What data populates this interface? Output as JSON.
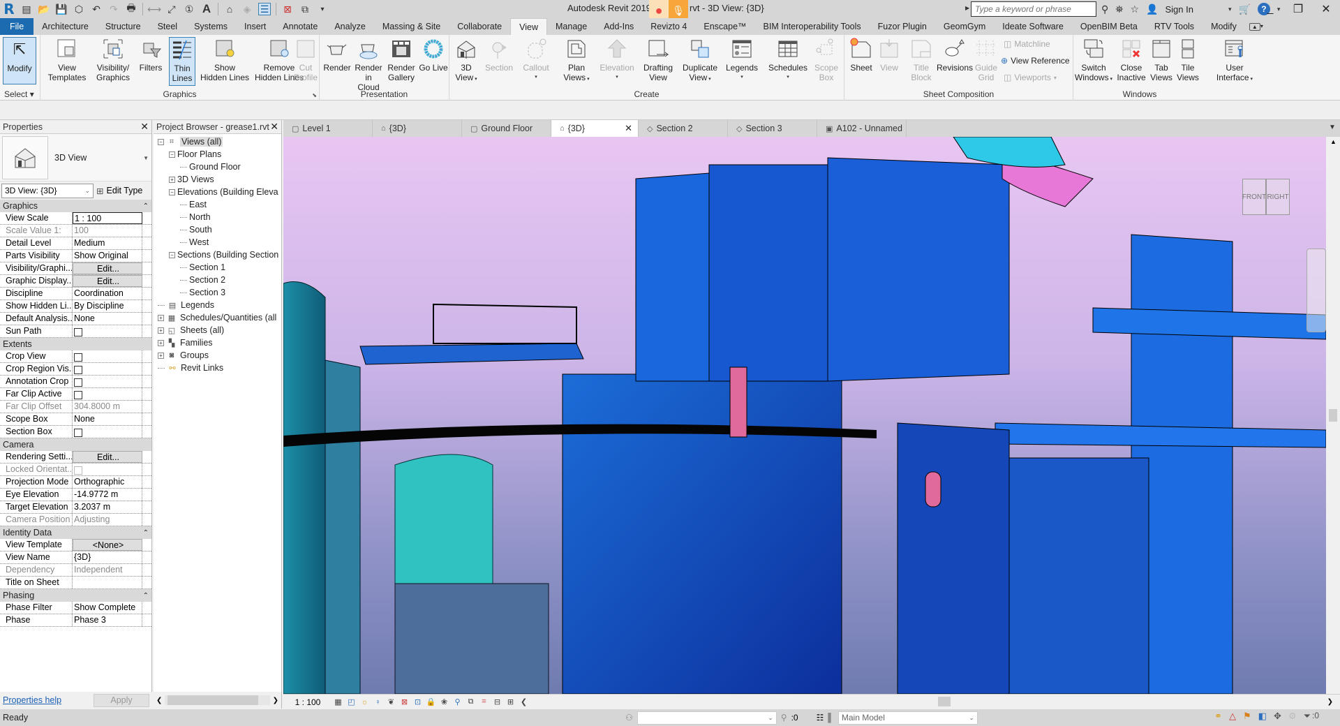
{
  "app": {
    "title_prefix": "Autodesk Revit 2019.2",
    "title_suffix": "rvt - 3D View: {3D}",
    "search_placeholder": "Type a keyword or phrase",
    "sign_in": "Sign In",
    "help": "?"
  },
  "quick_access": [
    "revit-logo",
    "recent-files",
    "open",
    "save",
    "sync",
    "undo",
    "redo",
    "print",
    "measure",
    "aligned-dimension",
    "tag",
    "text",
    "default-3d-view",
    "section",
    "thin-lines",
    "close-hidden-windows",
    "switch-windows",
    "customize"
  ],
  "ribbon_tabs": [
    "File",
    "Architecture",
    "Structure",
    "Steel",
    "Systems",
    "Insert",
    "Annotate",
    "Analyze",
    "Massing & Site",
    "Collaborate",
    "View",
    "Manage",
    "Add-Ins",
    "Revizto 4",
    "Enscape™",
    "BIM Interoperability Tools",
    "Fuzor Plugin",
    "GeomGym",
    "Ideate Software",
    "OpenBIM Beta",
    "RTV Tools",
    "Modify"
  ],
  "active_tab": "View",
  "ribbon": {
    "select": {
      "title": "Select",
      "modify": "Modify"
    },
    "graphics": {
      "title": "Graphics",
      "view_templates": [
        "View",
        "Templates"
      ],
      "visibility": [
        "Visibility/",
        "Graphics"
      ],
      "filters": "Filters",
      "thin_lines": [
        "Thin",
        "Lines"
      ],
      "show_hidden": [
        "Show",
        "Hidden Lines"
      ],
      "remove_hidden": [
        "Remove",
        "Hidden Lines"
      ],
      "cut_profile": [
        "Cut",
        "Profile"
      ]
    },
    "presentation": {
      "title": "Presentation",
      "render": "Render",
      "render_cloud": [
        "Render",
        "in Cloud"
      ],
      "render_gallery": [
        "Render",
        "Gallery"
      ],
      "go_live": "Go Live"
    },
    "create": {
      "title": "Create",
      "view3d": [
        "3D",
        "View"
      ],
      "section": "Section",
      "callout": "Callout",
      "plan_views": [
        "Plan",
        "Views"
      ],
      "elevation": "Elevation",
      "drafting": [
        "Drafting",
        "View"
      ],
      "duplicate": [
        "Duplicate",
        "View"
      ],
      "legends": "Legends",
      "schedules": "Schedules",
      "scope_box": [
        "Scope",
        "Box"
      ]
    },
    "sheet_composition": {
      "title": "Sheet Composition",
      "sheet": "Sheet",
      "view": "View",
      "title_block": [
        "Title",
        "Block"
      ],
      "revisions": "Revisions",
      "guide_grid": [
        "Guide",
        "Grid"
      ],
      "matchline": "Matchline",
      "view_reference": "View  Reference",
      "viewports": "Viewports"
    },
    "windows": {
      "title": "Windows",
      "switch": [
        "Switch",
        "Windows"
      ],
      "close_inactive": [
        "Close",
        "Inactive"
      ],
      "tab_views": [
        "Tab",
        "Views"
      ],
      "tile_views": [
        "Tile",
        "Views"
      ],
      "user_interface": [
        "User",
        "Interface"
      ]
    }
  },
  "properties": {
    "title": "Properties",
    "type_name": "3D View",
    "type_selector": "3D View: {3D}",
    "edit_type": "Edit Type",
    "sections": [
      {
        "name": "Graphics",
        "rows": [
          {
            "k": "View Scale",
            "v": "1 : 100",
            "style": "input"
          },
          {
            "k": "Scale Value    1:",
            "v": "100",
            "style": "dim"
          },
          {
            "k": "Detail Level",
            "v": "Medium"
          },
          {
            "k": "Parts Visibility",
            "v": "Show Original"
          },
          {
            "k": "Visibility/Graphi...",
            "v": "Edit...",
            "style": "button"
          },
          {
            "k": "Graphic Display...",
            "v": "Edit...",
            "style": "button"
          },
          {
            "k": "Discipline",
            "v": "Coordination"
          },
          {
            "k": "Show Hidden Li...",
            "v": "By Discipline"
          },
          {
            "k": "Default Analysis...",
            "v": "None"
          },
          {
            "k": "Sun Path",
            "v": "",
            "style": "checkbox",
            "checked": false
          }
        ]
      },
      {
        "name": "Extents",
        "rows": [
          {
            "k": "Crop View",
            "v": "",
            "style": "checkbox",
            "checked": false
          },
          {
            "k": "Crop Region Vis...",
            "v": "",
            "style": "checkbox",
            "checked": false
          },
          {
            "k": "Annotation Crop",
            "v": "",
            "style": "checkbox",
            "checked": false
          },
          {
            "k": "Far Clip Active",
            "v": "",
            "style": "checkbox",
            "checked": false
          },
          {
            "k": "Far Clip Offset",
            "v": "304.8000 m",
            "style": "dim"
          },
          {
            "k": "Scope Box",
            "v": "None"
          },
          {
            "k": "Section Box",
            "v": "",
            "style": "checkbox",
            "checked": false
          }
        ]
      },
      {
        "name": "Camera",
        "rows": [
          {
            "k": "Rendering Setti...",
            "v": "Edit...",
            "style": "button"
          },
          {
            "k": "Locked Orientat...",
            "v": "",
            "style": "checkbox-dim",
            "checked": false
          },
          {
            "k": "Projection Mode",
            "v": "Orthographic"
          },
          {
            "k": "Eye Elevation",
            "v": "-14.9772 m"
          },
          {
            "k": "Target Elevation",
            "v": "3.2037 m"
          },
          {
            "k": "Camera Position",
            "v": "Adjusting",
            "style": "dim"
          }
        ]
      },
      {
        "name": "Identity Data",
        "rows": [
          {
            "k": "View Template",
            "v": "<None>",
            "style": "button"
          },
          {
            "k": "View Name",
            "v": "{3D}"
          },
          {
            "k": "Dependency",
            "v": "Independent",
            "style": "dim"
          },
          {
            "k": "Title on Sheet",
            "v": ""
          }
        ]
      },
      {
        "name": "Phasing",
        "rows": [
          {
            "k": "Phase Filter",
            "v": "Show Complete"
          },
          {
            "k": "Phase",
            "v": "Phase 3"
          }
        ]
      }
    ],
    "help_link": "Properties help",
    "apply": "Apply"
  },
  "project_browser": {
    "title": "Project Browser - grease1.rvt",
    "tree": [
      {
        "label": "Views (all)",
        "level": 0,
        "exp": "-",
        "icon": "views-icon",
        "selected": true
      },
      {
        "label": "Floor Plans",
        "level": 1,
        "exp": "-"
      },
      {
        "label": "Ground Floor",
        "level": 2
      },
      {
        "label": "3D Views",
        "level": 1,
        "exp": "+"
      },
      {
        "label": "Elevations (Building Eleva",
        "level": 1,
        "exp": "-"
      },
      {
        "label": "East",
        "level": 2
      },
      {
        "label": "North",
        "level": 2
      },
      {
        "label": "South",
        "level": 2
      },
      {
        "label": "West",
        "level": 2
      },
      {
        "label": "Sections (Building Section",
        "level": 1,
        "exp": "-"
      },
      {
        "label": "Section 1",
        "level": 2
      },
      {
        "label": "Section 2",
        "level": 2
      },
      {
        "label": "Section 3",
        "level": 2
      },
      {
        "label": "Legends",
        "level": 0,
        "icon": "legends-icon"
      },
      {
        "label": "Schedules/Quantities (all",
        "level": 0,
        "exp": "+",
        "icon": "schedules-icon"
      },
      {
        "label": "Sheets (all)",
        "level": 0,
        "exp": "+",
        "icon": "sheets-icon"
      },
      {
        "label": "Families",
        "level": 0,
        "exp": "+",
        "icon": "families-icon"
      },
      {
        "label": "Groups",
        "level": 0,
        "exp": "+",
        "icon": "groups-icon"
      },
      {
        "label": "Revit Links",
        "level": 0,
        "icon": "revit-links-icon"
      }
    ]
  },
  "view_tabs": [
    {
      "label": "Level 1",
      "icon": "plan"
    },
    {
      "label": "{3D}",
      "icon": "3d"
    },
    {
      "label": "Ground Floor",
      "icon": "plan"
    },
    {
      "label": "{3D}",
      "icon": "3d",
      "active": true
    },
    {
      "label": "Section 2",
      "icon": "section"
    },
    {
      "label": "Section 3",
      "icon": "section"
    },
    {
      "label": "A102 - Unnamed",
      "icon": "sheet"
    }
  ],
  "viewcube": {
    "front": "FRONT",
    "right": "RIGHT"
  },
  "view_control": {
    "scale": "1 : 100"
  },
  "status": {
    "ready": "Ready",
    "worksets_count": ":0",
    "design_option": "Main Model",
    "filter_count": ":0"
  }
}
